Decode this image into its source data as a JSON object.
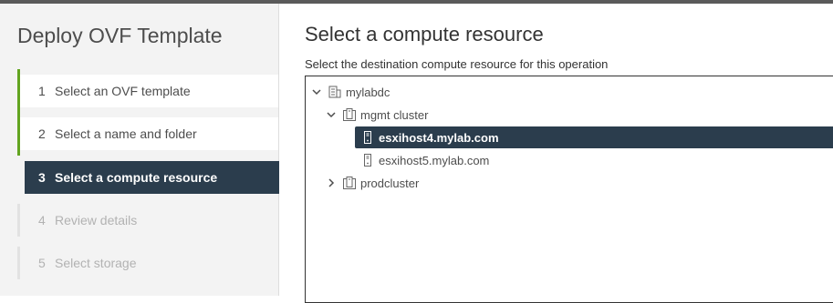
{
  "wizard": {
    "title": "Deploy OVF Template",
    "steps": [
      {
        "number": "1",
        "label": "Select an OVF template",
        "state": "completed"
      },
      {
        "number": "2",
        "label": "Select a name and folder",
        "state": "completed"
      },
      {
        "number": "3",
        "label": "Select a compute resource",
        "state": "current"
      },
      {
        "number": "4",
        "label": "Review details",
        "state": "pending"
      },
      {
        "number": "5",
        "label": "Select storage",
        "state": "pending"
      }
    ]
  },
  "main": {
    "title": "Select a compute resource",
    "subtitle": "Select the destination compute resource for this operation",
    "tree": [
      {
        "label": "mylabdc",
        "icon": "datacenter-icon",
        "expanded": true
      },
      {
        "label": "mgmt cluster",
        "icon": "cluster-icon",
        "expanded": true
      },
      {
        "label": "esxihost4.mylab.com",
        "icon": "host-icon",
        "selected": true
      },
      {
        "label": "esxihost5.mylab.com",
        "icon": "host-icon",
        "selected": false
      },
      {
        "label": "prodcluster",
        "icon": "cluster-icon",
        "expanded": false
      }
    ]
  },
  "colors": {
    "accent_complete": "#62a420",
    "selected_bg": "#2b3d4d",
    "top_bar": "#5a5a5a"
  }
}
